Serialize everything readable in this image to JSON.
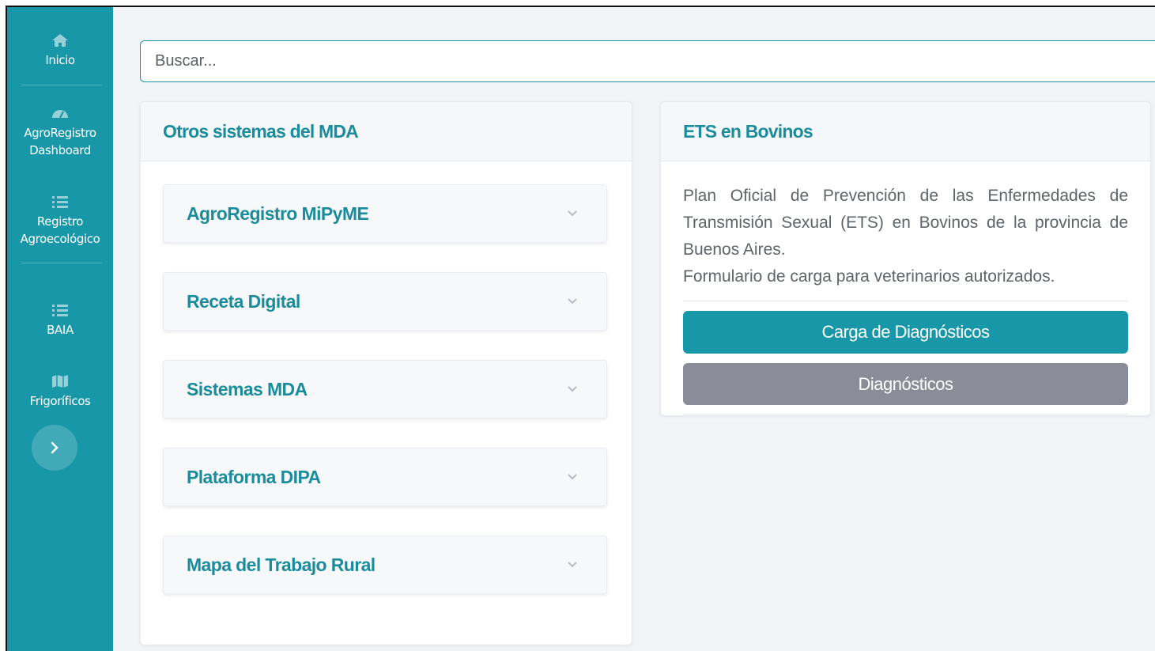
{
  "sidebar": {
    "items": [
      {
        "label": "Inicio",
        "icon": "home-icon"
      },
      {
        "label": "AgroRegistro\nDashboard",
        "icon": "dashboard-icon"
      },
      {
        "label": "Registro\nAgroecológico",
        "icon": "list-icon"
      },
      {
        "label": "BAIA",
        "icon": "list-icon"
      },
      {
        "label": "Frigoríficos",
        "icon": "map-icon"
      }
    ],
    "toggle_icon": "chevron-right-icon"
  },
  "search": {
    "placeholder": "Buscar..."
  },
  "left_card": {
    "title": "Otros sistemas del MDA",
    "accordion": [
      {
        "label": "AgroRegistro MiPyME"
      },
      {
        "label": "Receta Digital"
      },
      {
        "label": "Sistemas MDA"
      },
      {
        "label": "Plataforma DIPA"
      },
      {
        "label": "Mapa del Trabajo Rural"
      }
    ]
  },
  "right_card": {
    "title": "ETS en Bovinos",
    "description_1": "Plan Oficial de Prevención de las Enfermedades de Transmisión Sexual (ETS) en Bovinos de la provincia de Buenos Aires.",
    "description_2": "Formulario de carga para veterinarios autorizados.",
    "primary_button": "Carga de Diagnósticos",
    "secondary_button": "Diagnósticos"
  },
  "colors": {
    "brand": "#1897a8",
    "title": "#1a8c9c",
    "secondary_button": "#8a8d98"
  }
}
